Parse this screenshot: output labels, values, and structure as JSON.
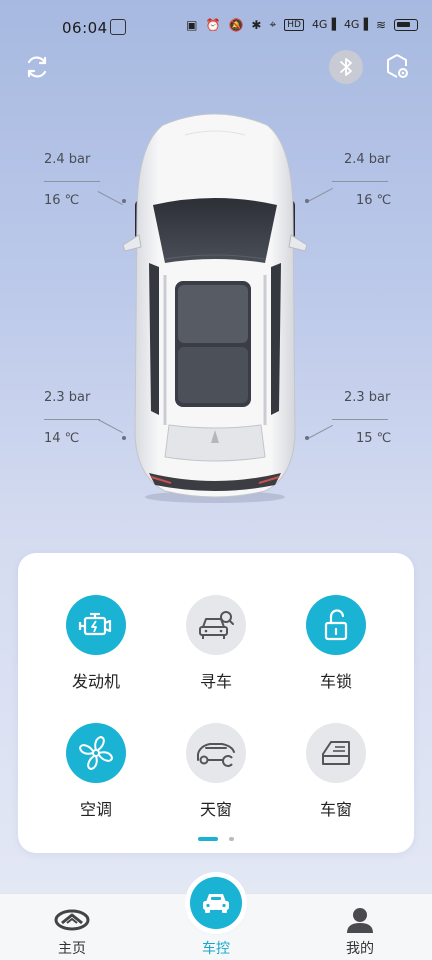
{
  "status_bar": {
    "time": "06:04",
    "network": "4G",
    "hd": "HD"
  },
  "top_bar": {
    "refresh_icon": "refresh-icon",
    "bluetooth_icon": "bluetooth-icon",
    "settings_icon": "car-settings-icon"
  },
  "tires": {
    "front_left": {
      "pressure": "2.4 bar",
      "temp": "16 ℃"
    },
    "front_right": {
      "pressure": "2.4 bar",
      "temp": "16 ℃"
    },
    "rear_left": {
      "pressure": "2.3 bar",
      "temp": "14 ℃"
    },
    "rear_right": {
      "pressure": "2.3 bar",
      "temp": "15 ℃"
    }
  },
  "controls": [
    {
      "label": "发动机",
      "icon": "engine-icon",
      "active": true
    },
    {
      "label": "寻车",
      "icon": "find-car-icon",
      "active": false
    },
    {
      "label": "车锁",
      "icon": "unlock-icon",
      "active": true
    },
    {
      "label": "空调",
      "icon": "fan-icon",
      "active": true
    },
    {
      "label": "天窗",
      "icon": "sunroof-icon",
      "active": false
    },
    {
      "label": "车窗",
      "icon": "window-icon",
      "active": false
    }
  ],
  "bottom_nav": {
    "home": "主页",
    "control": "车控",
    "mine": "我的"
  },
  "colors": {
    "accent": "#1bb3d4",
    "inactive_circle": "#e6e7ea"
  }
}
